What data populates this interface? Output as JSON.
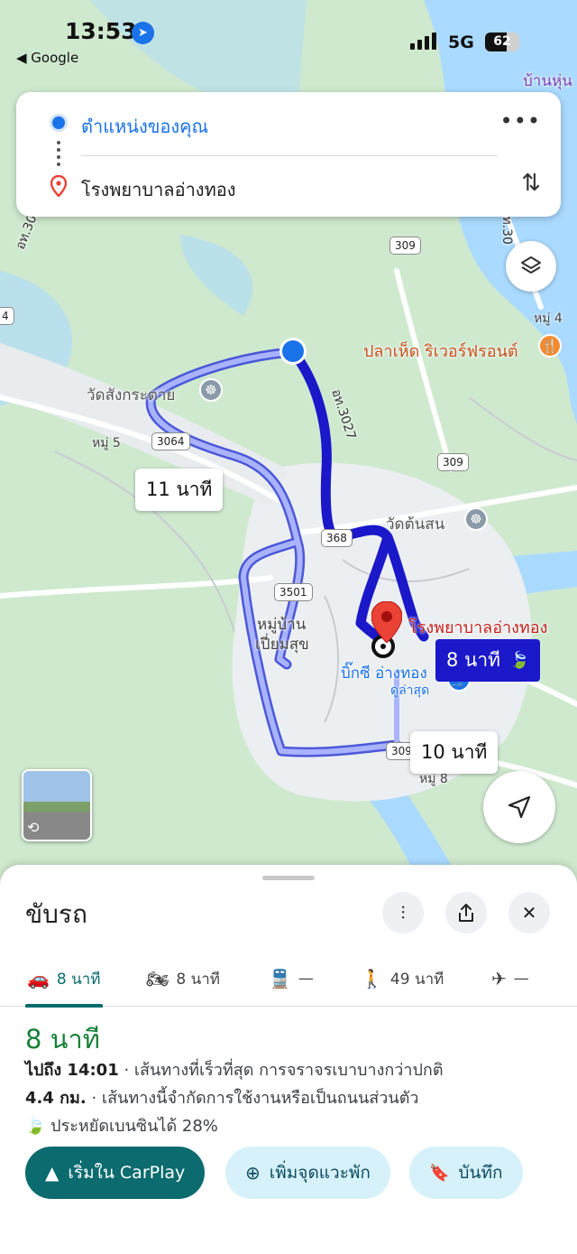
{
  "status_bar": {
    "time": "13:53",
    "back_app": "◀ Google",
    "network": "5G",
    "battery": "62",
    "battery_level": 0.62
  },
  "route": {
    "origin": "ตำแหน่งของคุณ",
    "destination": "โรงพยาบาลอ่างทอง",
    "more_icon": "more-horizontal-icon",
    "swap_icon": "swap-vertical-icon"
  },
  "map": {
    "labels": {
      "ban_hun": "บ้านหุ่น",
      "wat_sang_krachai": "วัดสังกระต่าย",
      "moo5": "หมู่ 5",
      "moo4": "หมู่ 4",
      "moo8": "หมู่ 8",
      "pla_hed": "ปลาเห็ด ริเวอร์ฟรอนต์",
      "wat_ton_son": "วัดต้นสน",
      "ban_pia_suk_1": "หมู่บ้าน",
      "ban_pia_suk_2": "เปี่ยมสุข",
      "hospital": "โรงพยาบาลอ่างทอง",
      "big_c": "บิ๊กซี อ่างทอง",
      "dulasud": "ดูล่าสุด",
      "road_3027": "อท.3027",
      "road_3027_left": "อท.3027",
      "road_right": "อท.30"
    },
    "shields": [
      "309",
      "309",
      "3064",
      "368",
      "3501",
      "309",
      "4"
    ],
    "chips": {
      "primary": "8 นาที",
      "alt1": "11 นาที",
      "alt2": "10 นาที"
    }
  },
  "sheet": {
    "mode_title": "ขับรถ",
    "tabs": [
      {
        "icon": "car-icon",
        "label": "8 นาที"
      },
      {
        "icon": "motorcycle-icon",
        "label": "8 นาที"
      },
      {
        "icon": "train-icon",
        "label": "—"
      },
      {
        "icon": "walk-icon",
        "label": "49 นาที"
      },
      {
        "icon": "airplane-icon",
        "label": "—"
      }
    ],
    "duration": "8 นาที",
    "arrive_label": "ไปถึง 14:01",
    "arrive_detail": " · เส้นทางที่เร็วที่สุด การจราจรเบาบางกว่าปกติ",
    "distance_label": "4.4 กม.",
    "distance_detail": " · เส้นทางนี้จำกัดการใช้งานหรือเป็นถนนส่วนตัว",
    "fuel_saving": "ประหยัดเบนซินได้ 28%",
    "actions": {
      "carplay": "เริ่มใน CarPlay",
      "add_stop": "เพิ่มจุดแวะพัก",
      "save": "บันทึก"
    }
  },
  "colors": {
    "primary_route": "#1a18c9",
    "alt_route": "#7a86f0",
    "accent_teal": "#0b6b6e",
    "eta_green": "#188038"
  }
}
